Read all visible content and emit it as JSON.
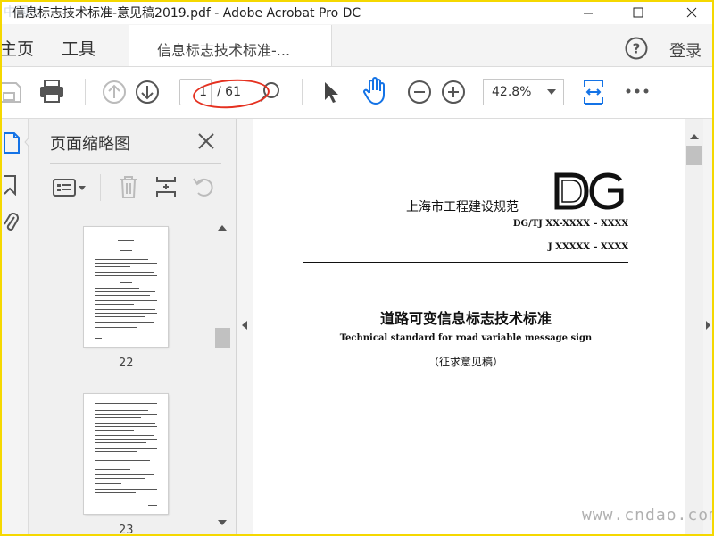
{
  "window": {
    "title": "信息标志技术标准-意见稿2019.pdf - Adobe Acrobat Pro DC",
    "watermark_top": "中国地"
  },
  "nav": {
    "home_label": "主页",
    "tools_label": "工具",
    "doc_tab_label": "信息标志技术标准-...",
    "help_icon": "question-circle-icon",
    "login_label": "登录"
  },
  "toolbar": {
    "page_current": "1",
    "page_total": "/ 61",
    "zoom": "42.8%",
    "annotation_color": "#e53120",
    "accent_color": "#1473e6"
  },
  "thumbnail_panel": {
    "title": "页面缩略图",
    "pages": [
      {
        "label": "22"
      },
      {
        "label": "23"
      }
    ]
  },
  "document": {
    "publisher": "上海市工程建设规范",
    "logo_text": "DG",
    "code_line1": "DG/TJ XX-XXXX – XXXX",
    "code_line2": "J XXXXX – XXXX",
    "title_cn": "道路可变信息标志技术标准",
    "title_en": "Technical standard for road variable message sign",
    "draft_note": "（征求意见稿）"
  },
  "watermark": "www.cndao.com"
}
